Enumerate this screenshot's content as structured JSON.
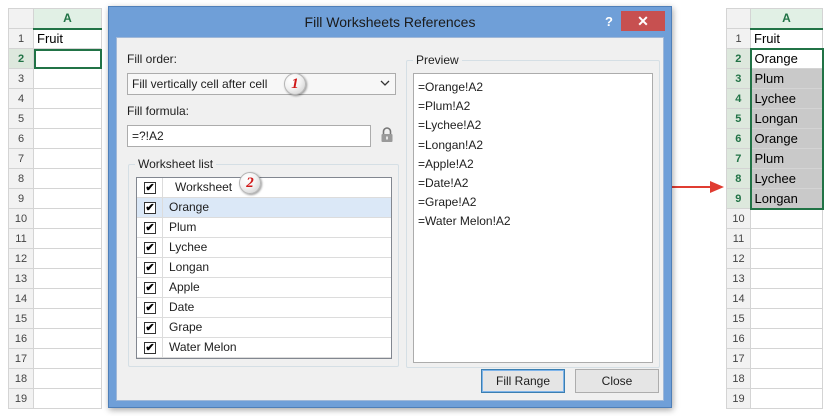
{
  "left_sheet": {
    "column_header": "A",
    "row_numbers": [
      "1",
      "2",
      "3",
      "4",
      "5",
      "6",
      "7",
      "8",
      "9",
      "10",
      "11",
      "12",
      "13",
      "14",
      "15",
      "16",
      "17",
      "18",
      "19"
    ],
    "cells": [
      "Fruit",
      "",
      "",
      "",
      "",
      "",
      "",
      "",
      "",
      "",
      "",
      "",
      "",
      "",
      "",
      "",
      "",
      "",
      ""
    ]
  },
  "right_sheet": {
    "column_header": "A",
    "row_numbers": [
      "1",
      "2",
      "3",
      "4",
      "5",
      "6",
      "7",
      "8",
      "9",
      "10",
      "11",
      "12",
      "13",
      "14",
      "15",
      "16",
      "17",
      "18",
      "19"
    ],
    "cells": [
      "Fruit",
      "Orange",
      "Plum",
      "Lychee",
      "Longan",
      "Orange",
      "Plum",
      "Lychee",
      "Longan",
      "",
      "",
      "",
      "",
      "",
      "",
      "",
      "",
      "",
      ""
    ]
  },
  "dialog": {
    "title": "Fill Worksheets References",
    "help_label": "?",
    "close_label": "✕",
    "fill_order_label": "Fill order:",
    "fill_order_value": "Fill vertically cell after cell",
    "fill_formula_label": "Fill formula:",
    "fill_formula_value": "=?!A2",
    "worksheet_list_label": "Worksheet list",
    "worksheet_header": "Worksheet",
    "worksheets": [
      "Orange",
      "Plum",
      "Lychee",
      "Longan",
      "Apple",
      "Date",
      "Grape",
      "Water Melon"
    ],
    "check_mark": "✔",
    "preview_label": "Preview",
    "preview_lines": [
      "=Orange!A2",
      "=Plum!A2",
      "=Lychee!A2",
      "=Longan!A2",
      "=Apple!A2",
      "=Date!A2",
      "=Grape!A2",
      "=Water Melon!A2"
    ],
    "fill_range_button": "Fill Range",
    "close_button": "Close"
  },
  "badges": {
    "first": "1",
    "second": "2"
  },
  "colors": {
    "excel_green": "#217346",
    "titlebar": "#6f9fd8",
    "close_red": "#c75050",
    "badge_text": "#d01818",
    "arrow": "#e03c31",
    "filled_cell": "#c9c9c9"
  }
}
